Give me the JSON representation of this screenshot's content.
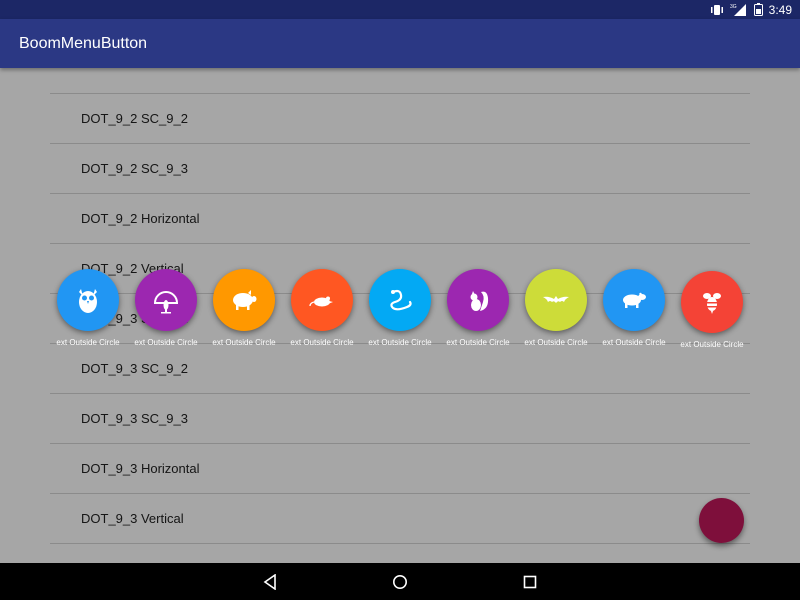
{
  "status_bar": {
    "time": "3:49",
    "network": "3G",
    "icons": [
      "vibrate-icon",
      "signal-icon",
      "battery-icon"
    ]
  },
  "app_bar": {
    "title": "BoomMenuButton"
  },
  "list": {
    "items": [
      "DOT_9_2 SC_9_2",
      "DOT_9_2 SC_9_3",
      "DOT_9_2 Horizontal",
      "DOT_9_2 Vertical",
      "DOT_9_3 SC_9_1",
      "DOT_9_3 SC_9_2",
      "DOT_9_3 SC_9_3",
      "DOT_9_3 Horizontal",
      "DOT_9_3 Vertical"
    ]
  },
  "boom_menu": {
    "buttons": [
      {
        "label": "ext Outside Circle",
        "color": "#2196f3",
        "icon": "owl-icon"
      },
      {
        "label": "ext Outside Circle",
        "color": "#9c27b0",
        "icon": "peacock-icon"
      },
      {
        "label": "ext Outside Circle",
        "color": "#ff9800",
        "icon": "pig-icon"
      },
      {
        "label": "ext Outside Circle",
        "color": "#ff5722",
        "icon": "mouse-icon"
      },
      {
        "label": "ext Outside Circle",
        "color": "#03a9f4",
        "icon": "snake-icon"
      },
      {
        "label": "ext Outside Circle",
        "color": "#9c27b0",
        "icon": "squirrel-icon"
      },
      {
        "label": "ext Outside Circle",
        "color": "#cddc39",
        "icon": "bat-icon"
      },
      {
        "label": "ext Outside Circle",
        "color": "#2196f3",
        "icon": "bear-icon"
      },
      {
        "label": "ext Outside Circle",
        "color": "#f44336",
        "icon": "bee-icon"
      }
    ]
  },
  "fab": {
    "color": "#c2185b"
  },
  "nav_bar": {
    "buttons": [
      "back-icon",
      "home-icon",
      "recents-icon"
    ]
  }
}
